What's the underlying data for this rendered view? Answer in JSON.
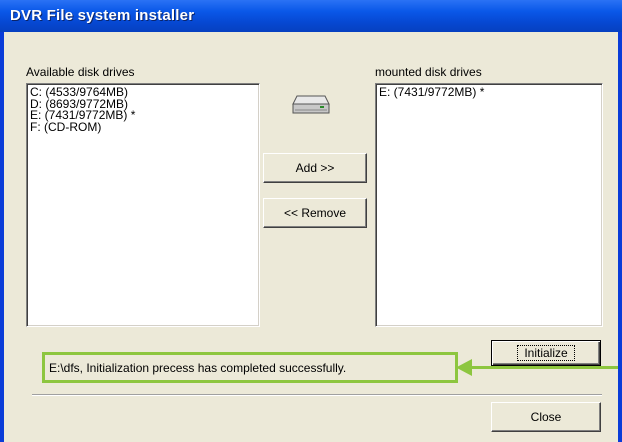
{
  "window": {
    "title": "DVR File system installer"
  },
  "available": {
    "label": "Available disk drives",
    "items": [
      "C:  (4533/9764MB)",
      "D:  (8693/9772MB)",
      "E:  (7431/9772MB) *",
      "F:  (CD-ROM)"
    ]
  },
  "mounted": {
    "label": "mounted disk drives",
    "items": [
      "E:  (7431/9772MB) *"
    ]
  },
  "buttons": {
    "add": "Add >>",
    "remove": "<< Remove",
    "initialize": "Initialize",
    "close": "Close"
  },
  "status": {
    "text": "E:\\dfs, Initialization precess has completed successfully."
  },
  "colors": {
    "titlebar": "#0a58e8",
    "highlight": "#8dc63f",
    "dialog": "#ece9d8"
  },
  "icons": {
    "drive": "hard-drive-icon"
  }
}
